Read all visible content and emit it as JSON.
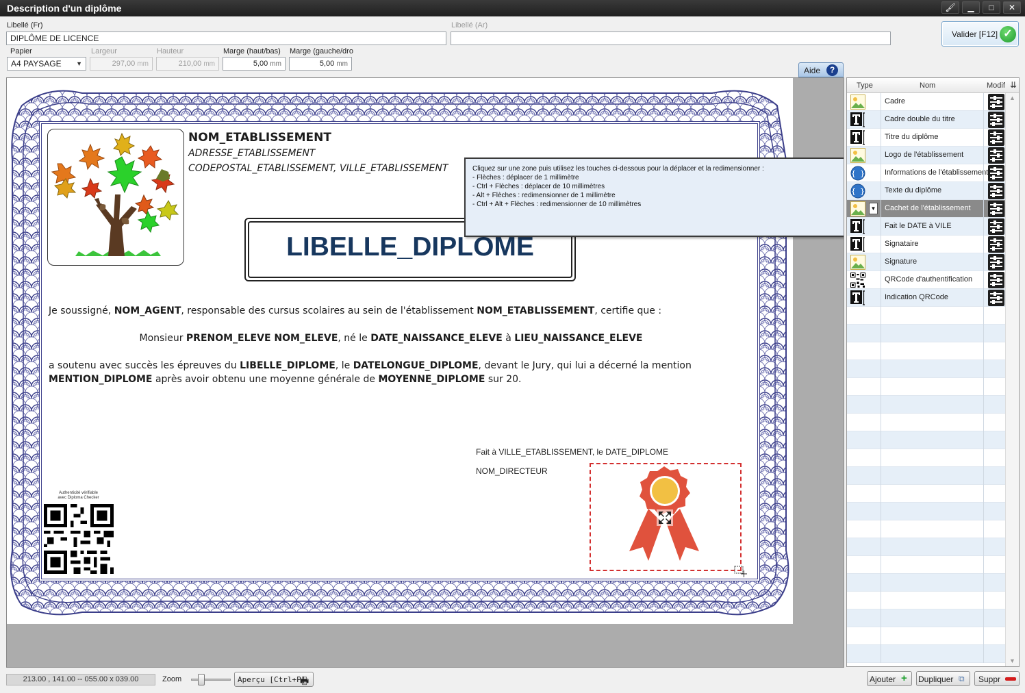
{
  "window": {
    "title": "Description d'un diplôme"
  },
  "form": {
    "libelle_fr_label": "Libellé (Fr)",
    "libelle_fr_value": "DIPLÔME DE LICENCE",
    "libelle_ar_label": "Libellé (Ar)",
    "libelle_ar_value": "",
    "papier_label": "Papier",
    "papier_value": "A4 PAYSAGE",
    "largeur_label": "Largeur",
    "largeur_value": "297,00",
    "hauteur_label": "Hauteur",
    "hauteur_value": "210,00",
    "marge_hb_label": "Marge (haut/bas)",
    "marge_hb_value": "5,00",
    "marge_gd_label": "Marge (gauche/dro",
    "marge_gd_value": "5,00",
    "unit": "mm"
  },
  "buttons": {
    "valider": "Valider [F12]",
    "aide": "Aide",
    "apercu": "Aperçu [Ctrl+P]",
    "ajouter": "Ajouter",
    "dupliquer": "Dupliquer",
    "suppr": "Suppr"
  },
  "help": {
    "lines": [
      "Cliquez sur une zone puis utilisez les touches ci-dessous pour la déplacer et la redimensionner :",
      "  - Flèches : déplacer de 1 millimètre",
      "  - Ctrl + Flèches : déplacer de 10 millimètres",
      "  - Alt + Flèches : redimensionner de 1 millimètre",
      "  - Ctrl + Alt + Flèches : redimensionner de 10 millimètres"
    ]
  },
  "diploma": {
    "etab_name": "NOM_ETABLISSEMENT",
    "etab_address": "ADRESSE_ETABLISSEMENT",
    "etab_city": "CODEPOSTAL_ETABLISSEMENT, VILLE_ETABLISSEMENT",
    "title": "LIBELLE_DIPLOME",
    "p1": [
      {
        "t": "Je soussigné, "
      },
      {
        "t": "NOM_AGENT",
        "b": true
      },
      {
        "t": ", responsable des cursus scolaires au sein de l'établissement "
      },
      {
        "t": "NOM_ETABLISSEMENT",
        "b": true
      },
      {
        "t": ", certifie que :"
      }
    ],
    "p2": [
      {
        "t": "Monsieur "
      },
      {
        "t": "PRENOM_ELEVE NOM_ELEVE",
        "b": true
      },
      {
        "t": ", né le "
      },
      {
        "t": "DATE_NAISSANCE_ELEVE",
        "b": true
      },
      {
        "t": " à "
      },
      {
        "t": "LIEU_NAISSANCE_ELEVE",
        "b": true
      }
    ],
    "p3a": [
      {
        "t": "a soutenu avec succès les épreuves du "
      },
      {
        "t": "LIBELLE_DIPLOME",
        "b": true
      },
      {
        "t": ", le "
      },
      {
        "t": "DATELONGUE_DIPLOME",
        "b": true
      },
      {
        "t": ", devant le Jury, qui lui a décerné la mention"
      }
    ],
    "p3b": [
      {
        "t": "MENTION_DIPLOME",
        "b": true
      },
      {
        "t": " après avoir obtenu une moyenne générale de "
      },
      {
        "t": "MOYENNE_DIPLOME",
        "b": true
      },
      {
        "t": " sur 20."
      }
    ],
    "fait_a": "Fait à VILLE_ETABLISSEMENT, le DATE_DIPLOME",
    "directeur": "NOM_DIRECTEUR",
    "qr_caption_1": "Authenticité vérifiable",
    "qr_caption_2": "avec Diploma Checker"
  },
  "table": {
    "col_type": "Type",
    "col_nom": "Nom",
    "col_modif": "Modif",
    "rows": [
      {
        "type": "image-icon",
        "name": "Cadre"
      },
      {
        "type": "text-icon",
        "name": "Cadre double du titre"
      },
      {
        "type": "text-icon",
        "name": "Titre du diplôme"
      },
      {
        "type": "image-icon",
        "name": "Logo de l'établissement"
      },
      {
        "type": "braces-icon",
        "name": "Informations de l'établissement"
      },
      {
        "type": "braces-icon",
        "name": "Texte du diplôme"
      },
      {
        "type": "image-icon",
        "name": "Cachet de l'établissement",
        "selected": true
      },
      {
        "type": "text-icon",
        "name": "Fait le DATE à VILE"
      },
      {
        "type": "text-icon",
        "name": "Signataire"
      },
      {
        "type": "image-icon",
        "name": "Signature"
      },
      {
        "type": "qrcode-icon",
        "name": "QRCode d'authentification"
      },
      {
        "type": "text-icon",
        "name": "Indication QRCode"
      }
    ]
  },
  "status": {
    "coords": "213.00 , 141.00 -- 055.00 x 039.00",
    "zoom_label": "Zoom"
  },
  "colors": {
    "title_color": "#17375e",
    "guilloche": "#3c3f8a",
    "stamp": "#e0523d",
    "stamp_center": "#f2c043"
  }
}
